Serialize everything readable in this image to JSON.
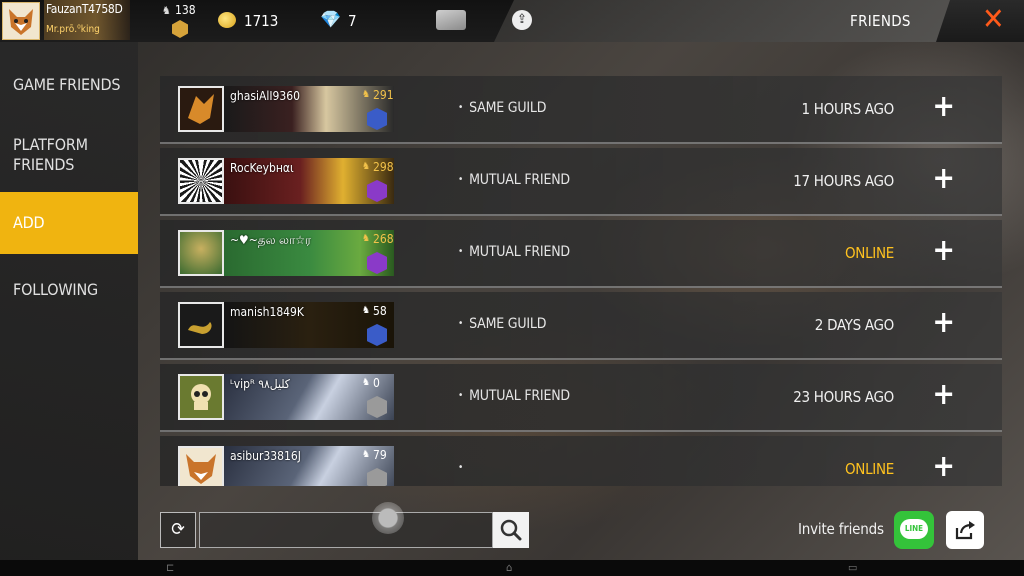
{
  "player": {
    "name": "FauzanT4758D",
    "tag": "Mr.prō.⁰king",
    "level": "138",
    "gold": "1713",
    "diamonds": "7"
  },
  "header": {
    "title": "FRIENDS",
    "close_label": "✕"
  },
  "sidebar": {
    "items": [
      {
        "label": "GAME FRIENDS"
      },
      {
        "label": "PLATFORM\nFRIENDS"
      },
      {
        "label": "ADD"
      },
      {
        "label": "FOLLOWING"
      }
    ]
  },
  "friends": [
    {
      "name": "ghasiAlI9360",
      "level": "291",
      "relation": "SAME GUILD",
      "last_seen": "1 HOURS AGO",
      "online": false
    },
    {
      "name": "RocKeybнαι",
      "level": "298",
      "relation": "MUTUAL FRIEND",
      "last_seen": "17 HOURS AGO",
      "online": false
    },
    {
      "name": "~♥~தல லா☆ர",
      "level": "268",
      "relation": "MUTUAL FRIEND",
      "last_seen": "ONLINE",
      "online": true
    },
    {
      "name": "manish1849K",
      "level": "58",
      "relation": "SAME GUILD",
      "last_seen": "2 DAYS AGO",
      "online": false
    },
    {
      "name": "ᴸvipᴿ كليل٩٨",
      "level": "0",
      "relation": "MUTUAL FRIEND",
      "last_seen": "23 HOURS AGO",
      "online": false
    },
    {
      "name": "asibur33816J",
      "level": "79",
      "relation": "",
      "last_seen": "ONLINE",
      "online": true
    }
  ],
  "add_label": "+",
  "search": {
    "placeholder": "",
    "value": ""
  },
  "refresh_label": "⟳",
  "invite": {
    "label": "Invite friends",
    "line_text": "LINE"
  },
  "colors": {
    "accent": "#f0b410",
    "online": "#ffc21f",
    "close": "#ff5a1a",
    "line_green": "#34c33a"
  }
}
